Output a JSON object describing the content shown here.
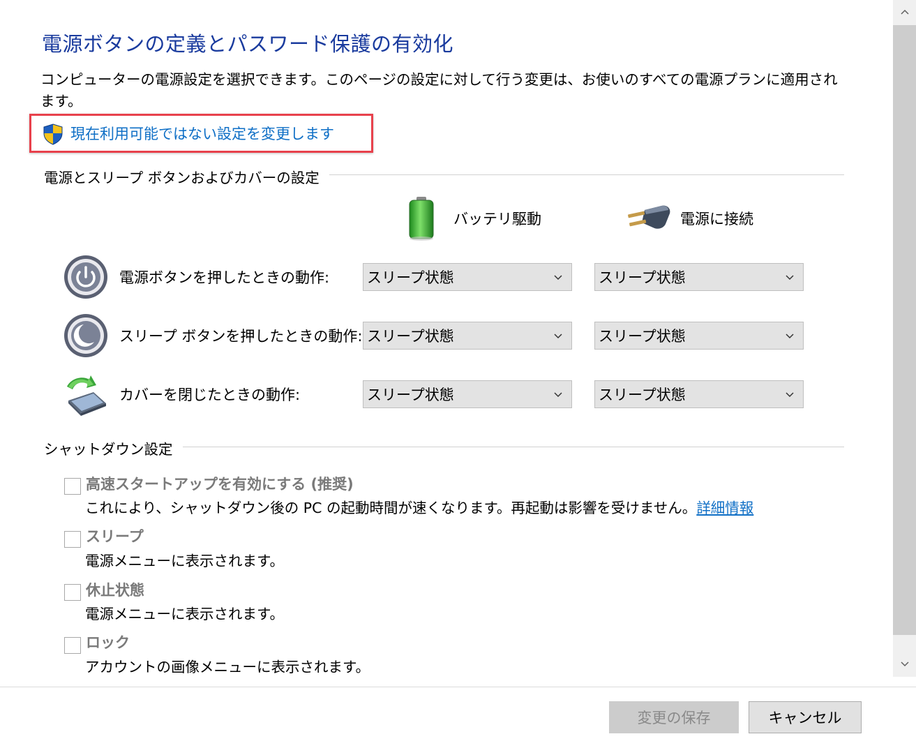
{
  "title": "電源ボタンの定義とパスワード保護の有効化",
  "intro": "コンピューターの電源設定を選択できます。このページの設定に対して行う変更は、お使いのすべての電源プランに適用されます。",
  "change_link": "現在利用可能ではない設定を変更します",
  "sections": {
    "buttons": "電源とスリープ ボタンおよびカバーの設定",
    "shutdown": "シャットダウン設定"
  },
  "columns": {
    "battery": "バッテリ駆動",
    "plugged": "電源に接続"
  },
  "rows": [
    {
      "label": "電源ボタンを押したときの動作:",
      "battery": "スリープ状態",
      "plugged": "スリープ状態"
    },
    {
      "label": "スリープ ボタンを押したときの動作:",
      "battery": "スリープ状態",
      "plugged": "スリープ状態"
    },
    {
      "label": "カバーを閉じたときの動作:",
      "battery": "スリープ状態",
      "plugged": "スリープ状態"
    }
  ],
  "shutdown_options": [
    {
      "label": "高速スタートアップを有効にする (推奨)",
      "desc": "これにより、シャットダウン後の PC の起動時間が速くなります。再起動は影響を受けません。",
      "checked": false
    },
    {
      "label": "スリープ",
      "desc": "電源メニューに表示されます。",
      "checked": false
    },
    {
      "label": "休止状態",
      "desc": "電源メニューに表示されます。",
      "checked": false
    },
    {
      "label": "ロック",
      "desc": "アカウントの画像メニューに表示されます。",
      "checked": false
    }
  ],
  "detail_link": "詳細情報",
  "buttons": {
    "save": "変更の保存",
    "cancel": "キャンセル"
  },
  "colors": {
    "title": "#1a3b9e",
    "link": "#0f6fc6",
    "highlight": "#e8414c"
  }
}
